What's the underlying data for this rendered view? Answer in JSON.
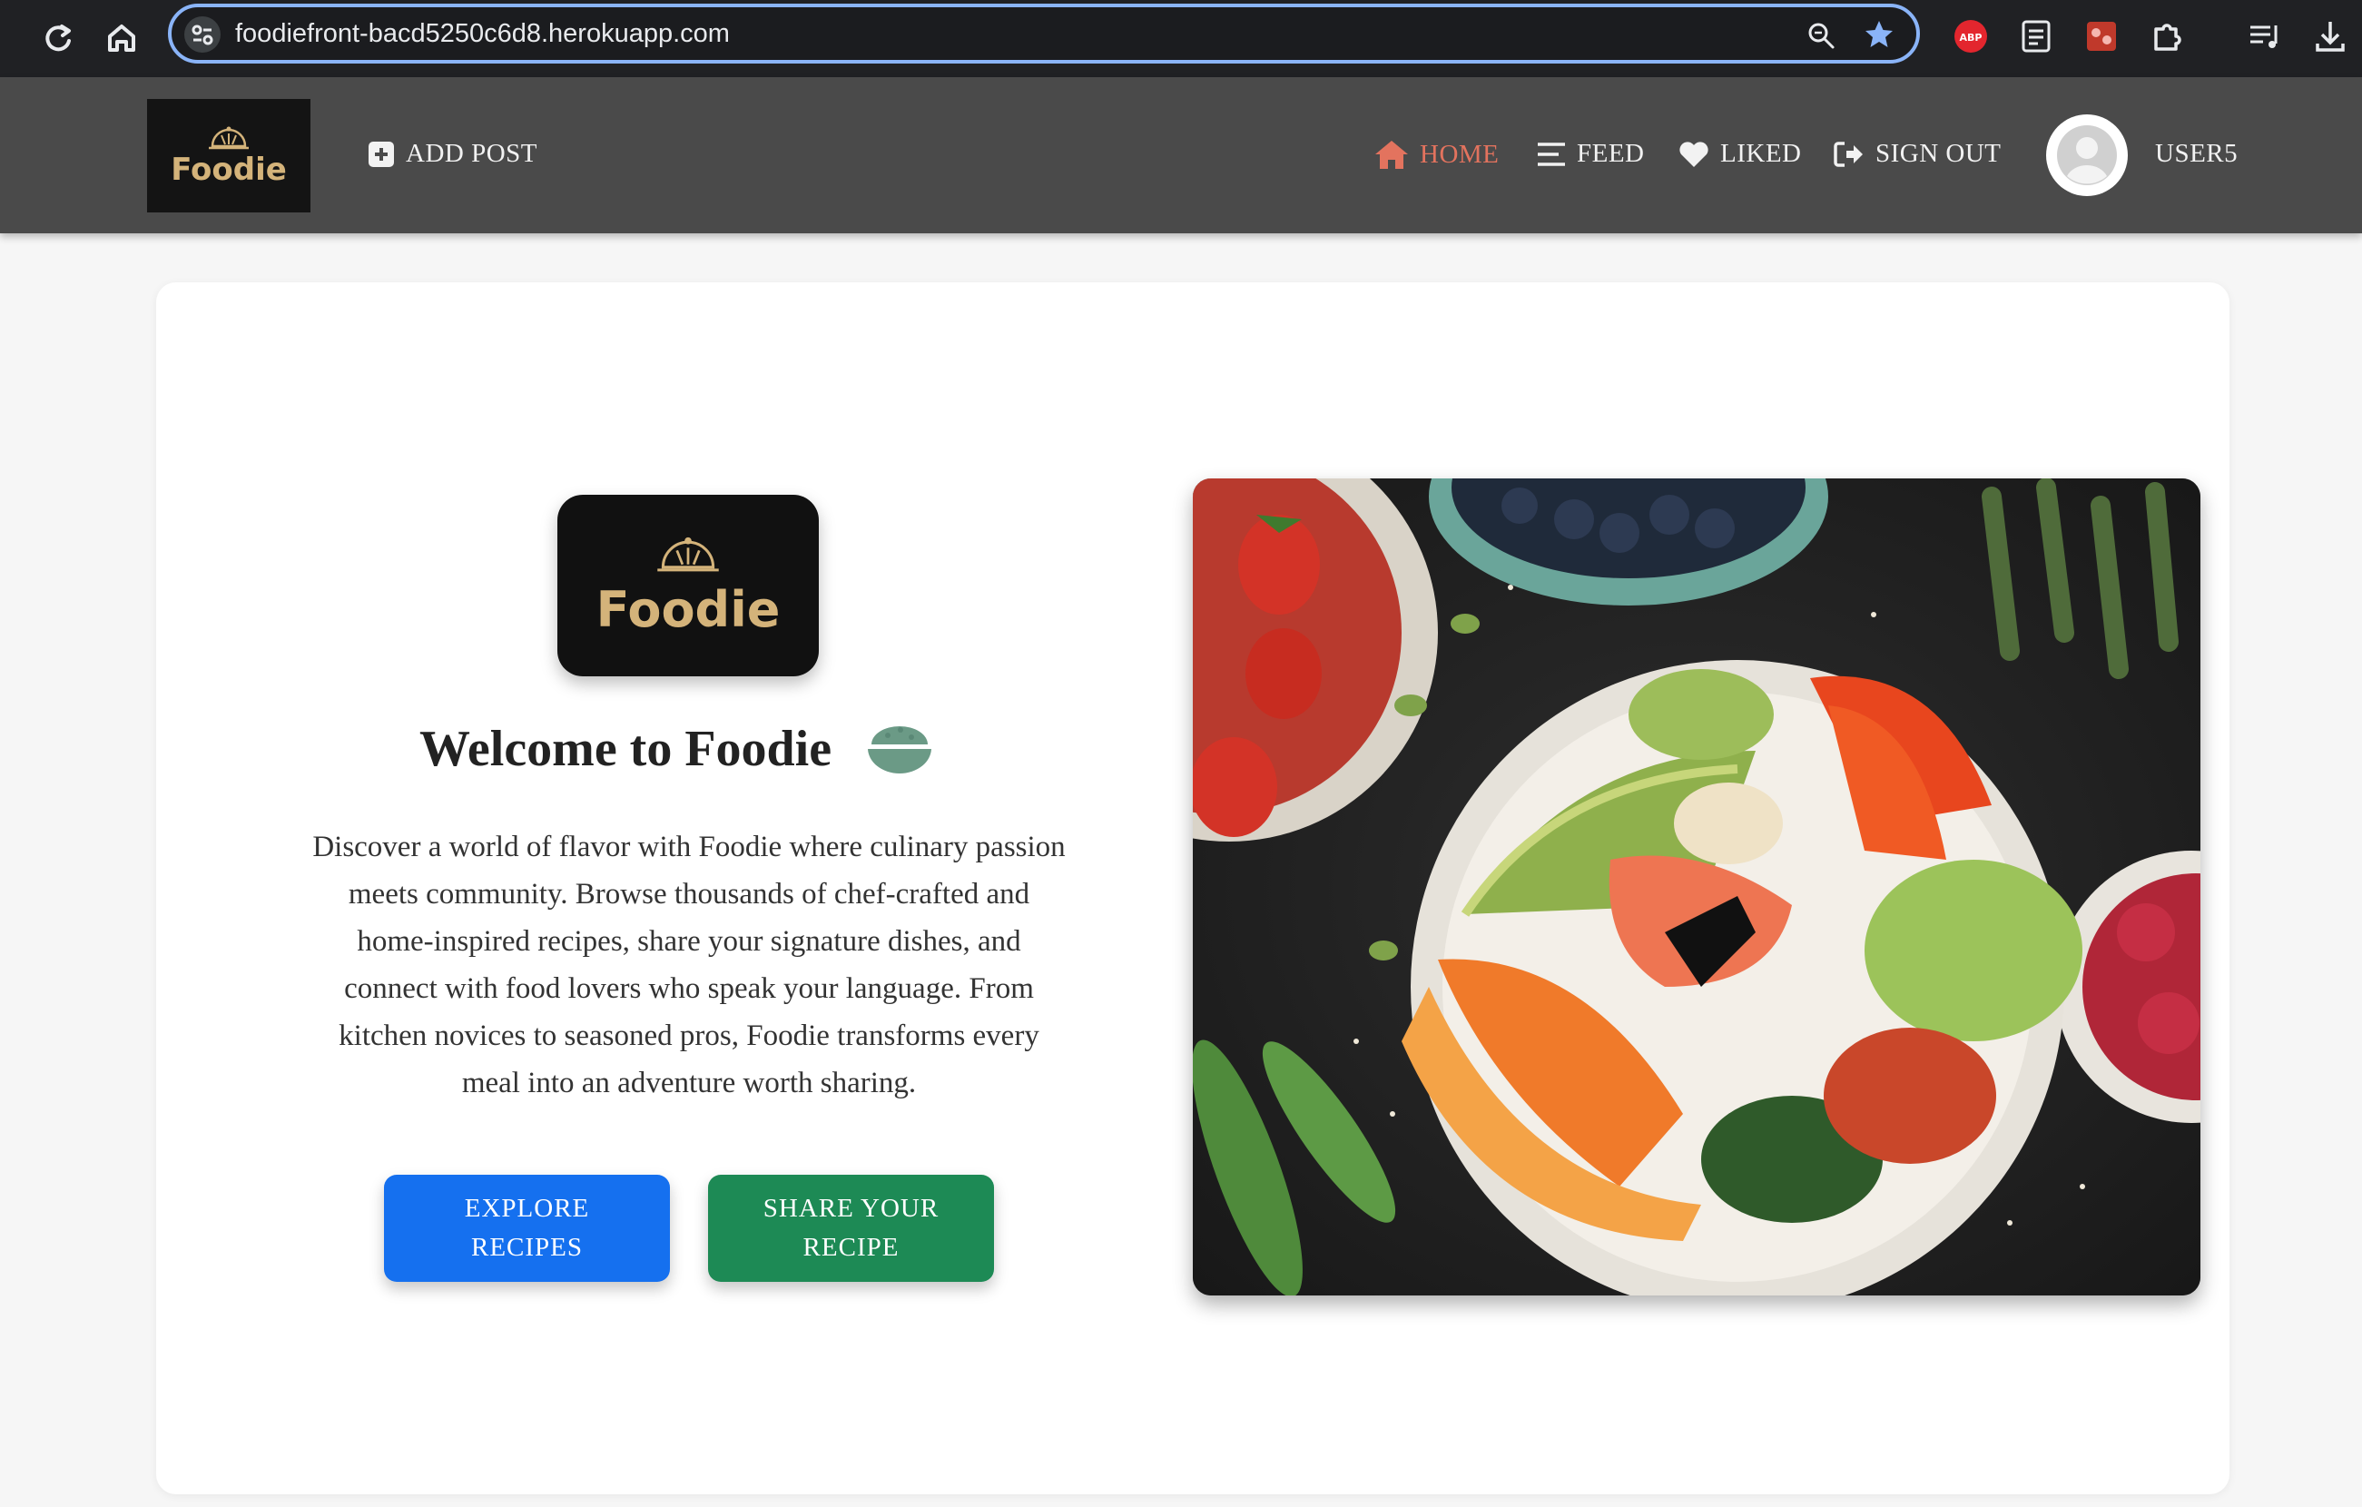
{
  "browser": {
    "url": "foodiefront-bacd5250c6d8.herokuapp.com"
  },
  "navbar": {
    "brand": "Foodie",
    "add_post": "ADD POST",
    "home": "HOME",
    "feed": "FEED",
    "liked": "LIKED",
    "sign_out": "SIGN OUT",
    "username": "USER5"
  },
  "hero": {
    "logo_text": "Foodie",
    "title": "Welcome to Foodie",
    "description_lines": [
      "Discover a world of flavor with Foodie where culinary passion",
      "meets community. Browse thousands of chef-crafted and",
      "home-inspired recipes, share your signature dishes, and",
      "connect with food lovers who speak your language. From",
      "kitchen novices to seasoned pros, Foodie transforms every",
      "meal into an adventure worth sharing."
    ],
    "explore_button": [
      "EXPLORE",
      "RECIPES"
    ],
    "share_button": [
      "SHARE YOUR",
      "RECIPE"
    ]
  },
  "colors": {
    "active_nav": "#e3735e",
    "explore": "#1570ef",
    "share": "#1d8a55",
    "bowl_icon": "#6b9a86",
    "brand_gold": "#d4b37a"
  }
}
